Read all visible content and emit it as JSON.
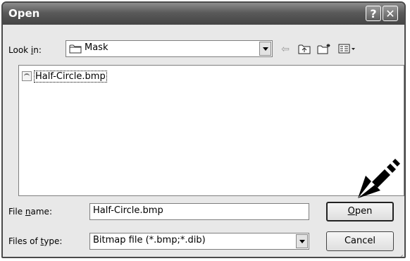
{
  "window": {
    "title": "Open",
    "help_label": "?",
    "close_label": "✕"
  },
  "lookin": {
    "label_prefix": "Look ",
    "label_accel": "i",
    "label_suffix": "n:",
    "value": "Mask"
  },
  "toolbar": {
    "back_icon": "back-arrow-icon",
    "up_icon": "up-folder-icon",
    "newfolder_icon": "new-folder-icon",
    "views_icon": "views-menu-icon"
  },
  "files": [
    {
      "name": "Half-Circle.bmp",
      "icon": "bitmap-file-icon"
    }
  ],
  "filename": {
    "label_prefix": "File ",
    "label_accel": "n",
    "label_suffix": "ame:",
    "value": "Half-Circle.bmp"
  },
  "filetype": {
    "label_prefix": "Files of ",
    "label_accel": "t",
    "label_suffix": "ype:",
    "value": "Bitmap file (*.bmp;*.dib)"
  },
  "buttons": {
    "open_accel": "O",
    "open_rest": "pen",
    "cancel": "Cancel"
  },
  "annotation": {
    "arrow": "pointer-arrow-graphic"
  }
}
